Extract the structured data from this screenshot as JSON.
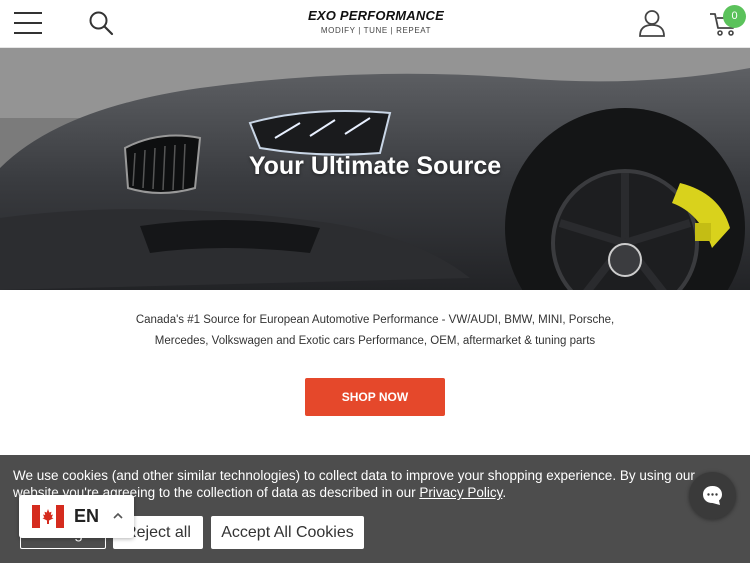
{
  "header": {
    "logo_main": "EXO PERFORMANCE",
    "logo_tagline": "MODIFY | TUNE | REPEAT",
    "cart_count": "0",
    "icons": [
      "menu-icon",
      "search-icon",
      "account-icon",
      "cart-icon"
    ]
  },
  "hero": {
    "title": "Your Ultimate Source"
  },
  "intro": {
    "text": "Canada's #1 Source for European Automotive Performance - VW/AUDI, BMW, MINI, Porsche, Mercedes, Volkswagen and Exotic cars Performance, OEM, aftermarket & tuning parts",
    "cta_label": "SHOP NOW"
  },
  "cookie_banner": {
    "text_before_link": "We use cookies (and other similar technologies) to collect data to improve your shopping experience. By using our website you're agreeing to the collection of data as described in our ",
    "link_label": "Privacy Policy",
    "text_after_link": ".",
    "manage_label": "Manage",
    "reject_label": "Reject all",
    "accept_label": "Accept All Cookies"
  },
  "language": {
    "code": "EN",
    "flag": "canada-flag-icon"
  },
  "colors": {
    "accent": "#e5482b",
    "cart_badge": "#5bc25b",
    "banner_bg": "#4d4d4d"
  }
}
